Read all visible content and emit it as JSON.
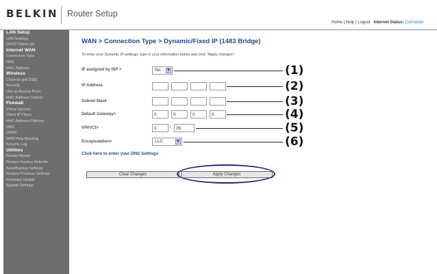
{
  "header": {
    "brand": "BELKIN",
    "app_title": "Router Setup",
    "links": [
      "Home",
      "Help",
      "Logout"
    ],
    "link_separator": " | ",
    "status_label": "Internet Status:",
    "status_value": "Connectio"
  },
  "sidebar": [
    {
      "section": "LAN Setup",
      "items": [
        "LAN Settings",
        "DHCP Client List"
      ]
    },
    {
      "section": "Internet WAN",
      "items": [
        "Connection Type",
        "DNS",
        "MAC Address"
      ]
    },
    {
      "section": "Wireless",
      "items": [
        "Channel and SSID",
        "Security",
        "Use as Access Point",
        "MAC Address Control"
      ]
    },
    {
      "section": "Firewall",
      "items": [
        "Virtual Servers",
        "Client IP Filters",
        "MAC Address Filtering",
        "DMZ",
        "DDNS",
        "WAN Ping Blocking",
        "Security Log"
      ]
    },
    {
      "section": "Utilities",
      "items": [
        "Restart Router",
        "Restore Factory Defaults",
        "Save/Backup Settings",
        "Restore Previous Settings",
        "Firmware Update",
        "System Settings"
      ]
    }
  ],
  "main": {
    "title": "WAN > Connection Type > Dynamic/Fixed IP (1483 Bridge)",
    "intro": "To enter your Dynamic IP settings, type in your information below and click \"Apply changes\".",
    "ip_assigned": {
      "label": "IP assigned by ISP >",
      "value": "No"
    },
    "ip_address": {
      "label": "IP Address",
      "octets": [
        "",
        "",
        "",
        ""
      ]
    },
    "subnet_mask": {
      "label": "Subnet Mask",
      "octets": [
        "",
        "",
        "",
        ""
      ]
    },
    "default_gateway": {
      "label": "Default Gateway>",
      "octets": [
        "0",
        "0",
        "0",
        "0"
      ]
    },
    "vpi_vci": {
      "label": "VPI/VCI>",
      "vpi": "0",
      "separator": "/",
      "vci": "35"
    },
    "encapsulation": {
      "label": "Encapsulation>",
      "value": "LLC"
    },
    "dns_link": "Click here to enter your DNS Settings",
    "clear_button": "Clear Changes",
    "apply_button": "Apply Changes"
  },
  "callouts": [
    "(1)",
    "(2)",
    "(3)",
    "(4)",
    "(5)",
    "(6)"
  ]
}
